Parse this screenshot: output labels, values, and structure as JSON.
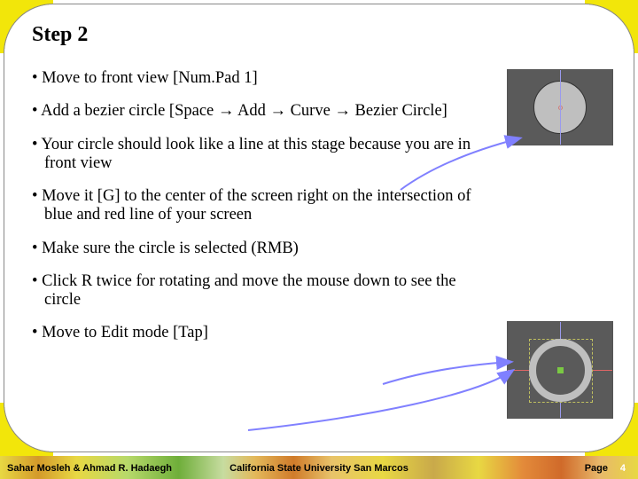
{
  "title": "Step 2",
  "bullets": [
    "Move to front view [Num.Pad 1]",
    "Add a bezier circle [Space → Add → Curve → Bezier Circle]",
    "Your circle should look like a line at this stage because you are in front view",
    "Move it [G] to the center of the screen right on the intersection of blue and red line of your screen",
    "Make sure the circle is selected (RMB)",
    "Click R twice for rotating and move the mouse down to see the circle",
    "Move to Edit mode [Tap]"
  ],
  "footer": {
    "authors": "Sahar Mosleh & Ahmad R. Hadaegh",
    "institution": "California State University San Marcos",
    "page_label": "Page",
    "page_number": "4"
  }
}
